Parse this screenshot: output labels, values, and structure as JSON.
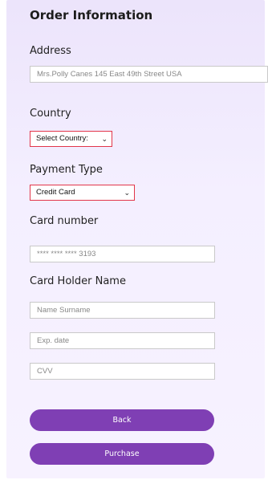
{
  "form": {
    "title": "Order Information",
    "address": {
      "label": "Address",
      "value": "Mrs.Polly Canes 145 East 49th Street USA"
    },
    "country": {
      "label": "Country",
      "selected": "Select Country:"
    },
    "payment_type": {
      "label": "Payment Type",
      "selected": "Credit Card"
    },
    "card_number": {
      "label": "Card number",
      "value": "**** **** **** 3193"
    },
    "card_holder": {
      "label": "Card Holder Name",
      "name_placeholder": "Name Surname",
      "exp_placeholder": "Exp. date",
      "cvv_placeholder": "CVV"
    },
    "buttons": {
      "back": "Back",
      "purchase": "Purchase"
    }
  },
  "colors": {
    "accent": "#7f3fb4",
    "select_border": "#e2364a",
    "panel_bg": "#f1eaff"
  },
  "icons": {
    "dropdown": "chevron-down-icon"
  }
}
